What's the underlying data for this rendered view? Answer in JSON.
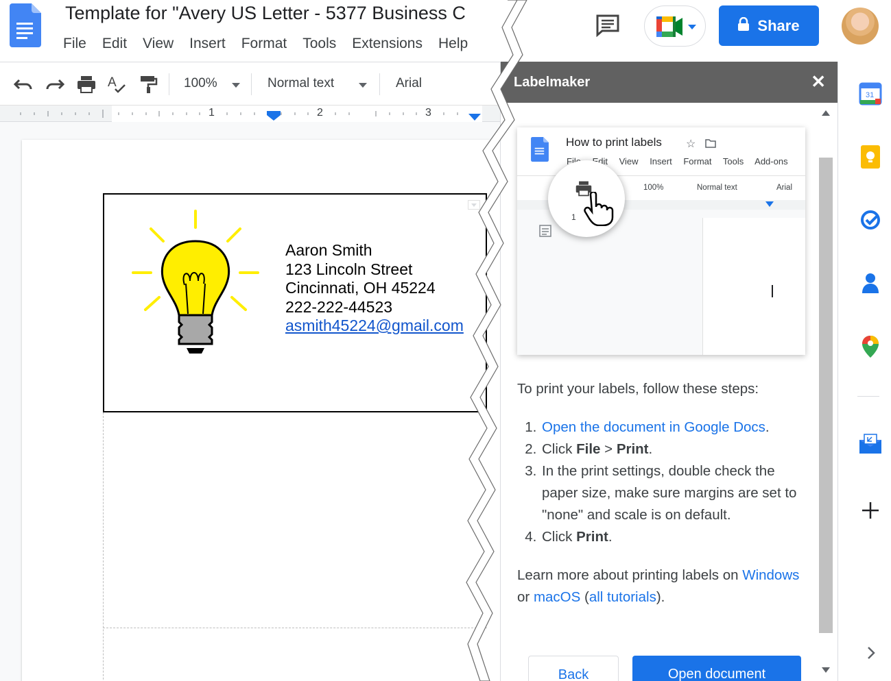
{
  "docs": {
    "title": "Template for \"Avery US Letter - 5377 Business C",
    "menu": [
      "File",
      "Edit",
      "View",
      "Insert",
      "Format",
      "Tools",
      "Extensions",
      "Help"
    ],
    "toolbar": {
      "zoom": "100%",
      "style": "Normal text",
      "font": "Arial"
    },
    "ruler": [
      "1",
      "2",
      "3"
    ],
    "label": {
      "name": "Aaron Smith",
      "street": "123 Lincoln Street",
      "city": "Cincinnati, OH 45224",
      "phone": "222-222-44523",
      "email": "asmith45224@gmail.com"
    }
  },
  "topbar": {
    "share_label": "Share"
  },
  "panel": {
    "title": "Labelmaker",
    "close": "✕",
    "preview": {
      "title": "How to print labels",
      "menu": [
        "File",
        "Edit",
        "View",
        "Insert",
        "Format",
        "Tools",
        "Add-ons"
      ],
      "zoom": "100%",
      "style": "Normal text",
      "font": "Arial",
      "ruler_num": "1"
    },
    "intro": "To print your labels, follow these steps:",
    "steps": {
      "s1_link": "Open the document in Google Docs",
      "s1_tail": ".",
      "s2_pre": "Click ",
      "s2_b1": "File",
      "s2_mid": " > ",
      "s2_b2": "Print",
      "s2_tail": ".",
      "s3": "In the print settings, double check the paper size, make sure margins are set to \"none\" and scale is on default.",
      "s4_pre": "Click ",
      "s4_b": "Print",
      "s4_tail": "."
    },
    "learn": {
      "pre": "Learn more about printing labels on ",
      "windows": "Windows",
      "or": " or ",
      "macos": "macOS",
      "open_paren": " (",
      "all": "all tutorials",
      "close_paren": ")."
    },
    "back_label": "Back",
    "open_label": "Open document"
  },
  "colors": {
    "accent": "#1a73e8",
    "panel_header": "#616161",
    "bulb": "#ffee00"
  }
}
